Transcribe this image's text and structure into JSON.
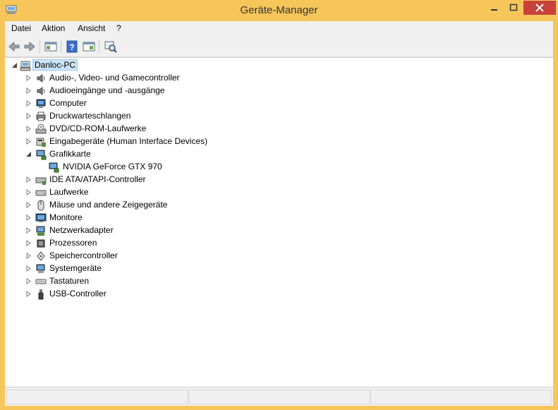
{
  "window": {
    "title": "Geräte-Manager"
  },
  "menu": [
    "Datei",
    "Aktion",
    "Ansicht",
    "?"
  ],
  "toolbar": {
    "buttons": [
      "back-arrow-icon",
      "forward-arrow-icon",
      "properties-view-icon",
      "help-icon",
      "show-pane-icon",
      "scan-hardware-icon"
    ]
  },
  "tree": {
    "root": "Danloc-PC",
    "categories": [
      {
        "label": "Audio-, Video- und Gamecontroller",
        "icon": "speaker-icon",
        "expanded": false
      },
      {
        "label": "Audioeingänge und -ausgänge",
        "icon": "speaker-icon",
        "expanded": false
      },
      {
        "label": "Computer",
        "icon": "computer-icon",
        "expanded": false
      },
      {
        "label": "Druckwarteschlangen",
        "icon": "printer-icon",
        "expanded": false
      },
      {
        "label": "DVD/CD-ROM-Laufwerke",
        "icon": "dvd-drive-icon",
        "expanded": false
      },
      {
        "label": "Eingabegeräte (Human Interface Devices)",
        "icon": "hid-icon",
        "expanded": false
      },
      {
        "label": "Grafikkarte",
        "icon": "display-adapter-icon",
        "expanded": true,
        "children": [
          "NVIDIA GeForce GTX 970"
        ]
      },
      {
        "label": "IDE ATA/ATAPI-Controller",
        "icon": "ide-controller-icon",
        "expanded": false
      },
      {
        "label": "Laufwerke",
        "icon": "disk-drive-icon",
        "expanded": false
      },
      {
        "label": "Mäuse und andere Zeigegeräte",
        "icon": "mouse-icon",
        "expanded": false
      },
      {
        "label": "Monitore",
        "icon": "monitor-icon",
        "expanded": false
      },
      {
        "label": "Netzwerkadapter",
        "icon": "network-adapter-icon",
        "expanded": false
      },
      {
        "label": "Prozessoren",
        "icon": "processor-icon",
        "expanded": false
      },
      {
        "label": "Speichercontroller",
        "icon": "storage-controller-icon",
        "expanded": false
      },
      {
        "label": "Systemgeräte",
        "icon": "system-devices-icon",
        "expanded": false
      },
      {
        "label": "Tastaturen",
        "icon": "keyboard-icon",
        "expanded": false
      },
      {
        "label": "USB-Controller",
        "icon": "usb-icon",
        "expanded": false
      }
    ]
  },
  "colors": {
    "frame": "#f6c65a",
    "close_button": "#c8413b",
    "selection_fill": "#cce4f7",
    "selection_border": "#99c9ef"
  }
}
